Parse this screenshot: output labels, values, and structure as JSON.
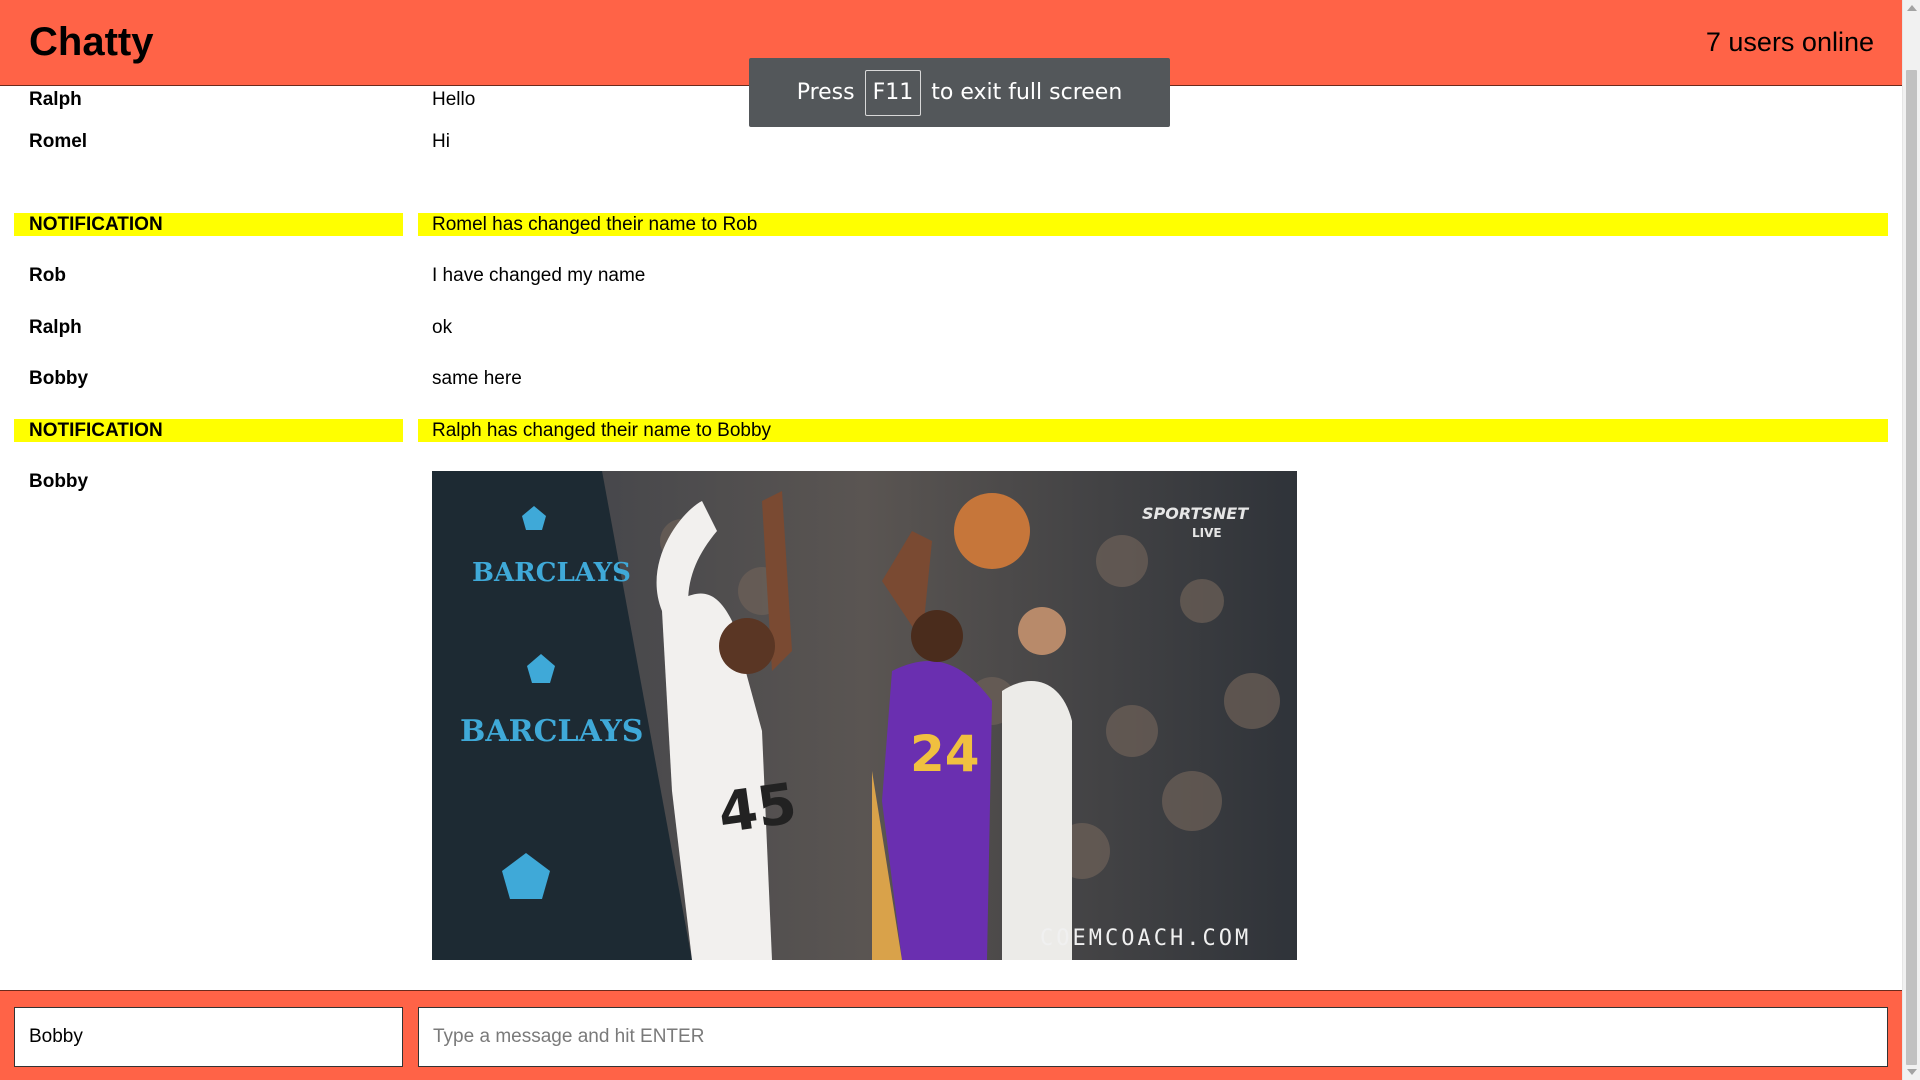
{
  "header": {
    "title": "Chatty",
    "online_count": "7 users online"
  },
  "fullscreen_toast": {
    "prefix": "Press",
    "key": "F11",
    "suffix": "to exit full screen"
  },
  "messages": [
    {
      "user": "Ralph",
      "text": "Hello",
      "type": "message"
    },
    {
      "user": "Romel",
      "text": "Hi",
      "type": "message"
    },
    {
      "user": "NOTIFICATION",
      "text": "Romel has changed their name to Rob",
      "type": "notification"
    },
    {
      "user": "Rob",
      "text": "I have changed my name",
      "type": "message"
    },
    {
      "user": "Ralph",
      "text": "ok",
      "type": "message"
    },
    {
      "user": "Bobby",
      "text": "same here",
      "type": "message"
    },
    {
      "user": "NOTIFICATION",
      "text": "Ralph has changed their name to Bobby",
      "type": "notification"
    },
    {
      "user": "Bobby",
      "text": "",
      "type": "image"
    }
  ],
  "gif": {
    "banner_text": "BARCLAYS",
    "jersey_1": "45",
    "jersey_2": "24",
    "broadcaster": "SPORTSNET",
    "broadcaster_sub": "LIVE",
    "watermark": "COEMCOACH.COM"
  },
  "footer": {
    "username_value": "Bobby",
    "message_placeholder": "Type a message and hit ENTER"
  },
  "colors": {
    "accent": "#ff6347",
    "notification": "#ffff00"
  }
}
